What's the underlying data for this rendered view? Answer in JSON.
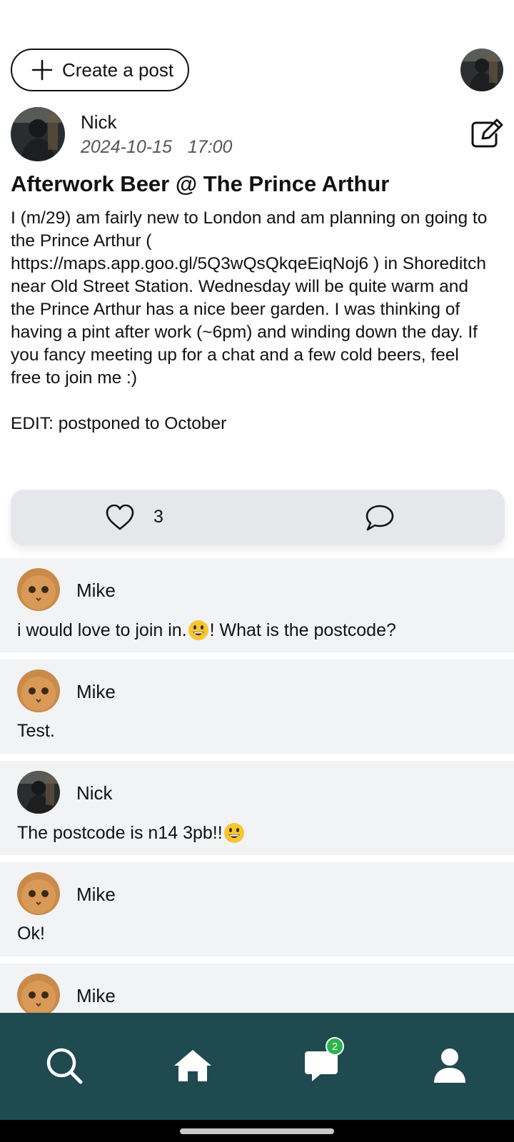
{
  "header": {
    "create_post_label": "Create a post",
    "plus_icon": "plus-icon",
    "profile_avatar": "user-avatar"
  },
  "post": {
    "author": "Nick",
    "date": "2024-10-15",
    "time": "17:00",
    "title": "Afterwork Beer @ The Prince Arthur",
    "body": "I (m/29) am fairly new to London and am planning on going to the Prince Arthur ( https://maps.app.goo.gl/5Q3wQsQkqeEiqNoj6 ) in Shoreditch near Old Street Station. Wednesday will be quite warm and the Prince Arthur has a nice beer garden. I was thinking of having a pint after work (~6pm) and winding down the day. If you fancy meeting up for a chat and a few cold beers, feel free to join me :)\n\nEDIT: postponed to October",
    "edit_icon": "edit-icon"
  },
  "actions": {
    "like_count": "3",
    "like_icon": "heart-icon",
    "comment_icon": "comment-icon"
  },
  "comments": [
    {
      "author": "Mike",
      "text_before": "i would love to join in. ",
      "emoji": "grinning-face",
      "text_after": "! What is the postcode?"
    },
    {
      "author": "Mike",
      "text_before": "Test.",
      "emoji": "",
      "text_after": ""
    },
    {
      "author": "Nick",
      "text_before": "The postcode is n14 3pb!!",
      "emoji": "grinning-face",
      "text_after": ""
    },
    {
      "author": "Mike",
      "text_before": "Ok!",
      "emoji": "",
      "text_after": ""
    },
    {
      "author": "Mike",
      "text_before": "",
      "emoji": "",
      "text_after": ""
    }
  ],
  "bottom_nav": {
    "items": [
      "search-icon",
      "home-icon",
      "messages-icon",
      "profile-icon"
    ],
    "messages_badge": "2",
    "background": "#1f4a4f",
    "badge_color": "#2bb34b"
  }
}
